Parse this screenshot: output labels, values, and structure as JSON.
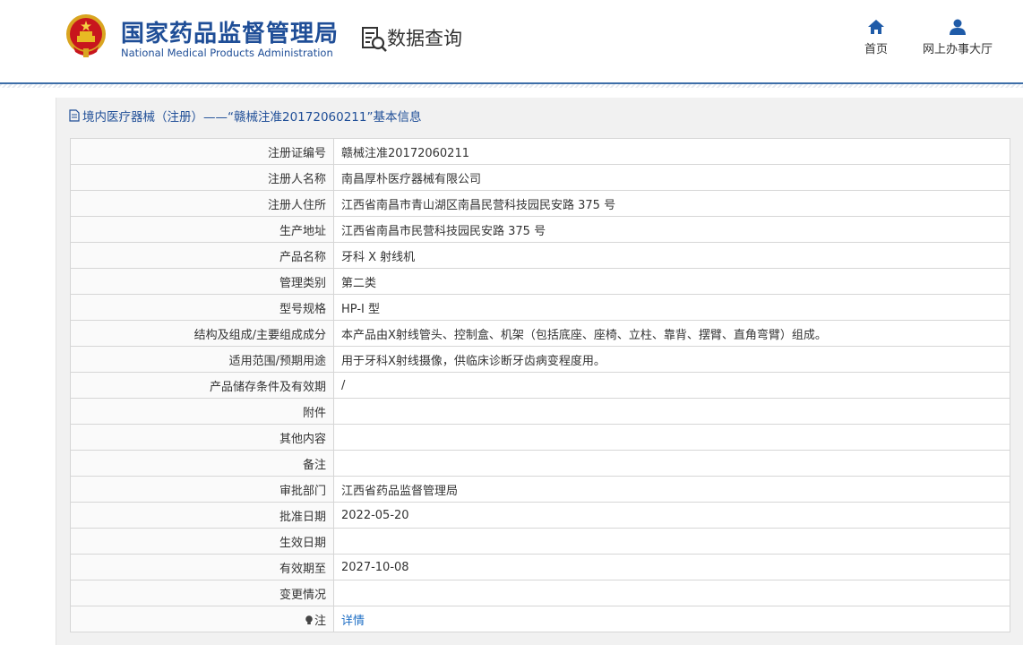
{
  "header": {
    "logo_cn": "国家药品监督管理局",
    "logo_en": "National Medical Products Administration",
    "query_title": "数据查询",
    "nav": [
      {
        "label": "首页",
        "icon": "home-icon"
      },
      {
        "label": "网上办事大厅",
        "icon": "user-icon"
      }
    ]
  },
  "panel": {
    "title": "境内医疗器械（注册）——“赣械注准20172060211”基本信息",
    "rows": [
      {
        "label": "注册证编号",
        "value": "赣械注准20172060211"
      },
      {
        "label": "注册人名称",
        "value": "南昌厚朴医疗器械有限公司"
      },
      {
        "label": "注册人住所",
        "value": "江西省南昌市青山湖区南昌民营科技园民安路 375 号"
      },
      {
        "label": "生产地址",
        "value": "江西省南昌市民营科技园民安路 375 号"
      },
      {
        "label": "产品名称",
        "value": "牙科 X 射线机"
      },
      {
        "label": "管理类别",
        "value": "第二类"
      },
      {
        "label": "型号规格",
        "value": "HP-I 型"
      },
      {
        "label": "结构及组成/主要组成成分",
        "value": "本产品由X射线管头、控制盒、机架（包括底座、座椅、立柱、靠背、摆臂、直角弯臂）组成。"
      },
      {
        "label": "适用范围/预期用途",
        "value": "用于牙科X射线摄像，供临床诊断牙齿病变程度用。"
      },
      {
        "label": "产品储存条件及有效期",
        "value": "/"
      },
      {
        "label": "附件",
        "value": ""
      },
      {
        "label": "其他内容",
        "value": ""
      },
      {
        "label": "备注",
        "value": ""
      },
      {
        "label": "审批部门",
        "value": "江西省药品监督管理局"
      },
      {
        "label": "批准日期",
        "value": "2022-05-20"
      },
      {
        "label": "生效日期",
        "value": ""
      },
      {
        "label": "有效期至",
        "value": "2027-10-08"
      },
      {
        "label": "变更情况",
        "value": ""
      }
    ],
    "note": {
      "label": "注",
      "icon": "bulb-icon",
      "link": "详情"
    }
  }
}
